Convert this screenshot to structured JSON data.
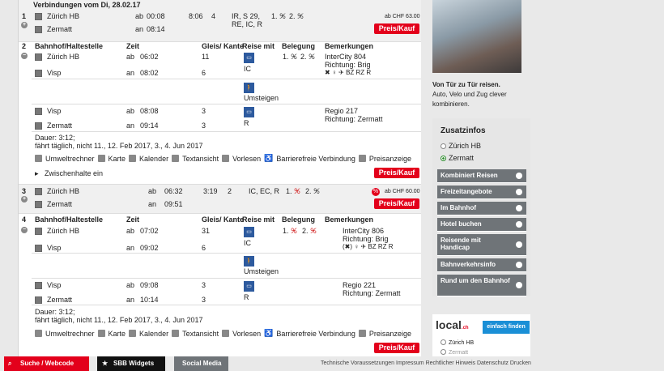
{
  "header": {
    "title": "Verbindungen vom Di, 28.02.17"
  },
  "c1": {
    "num": "1",
    "from": "Zürich HB",
    "to": "Zermatt",
    "dep_k": "ab",
    "arr_k": "an",
    "dep": "00:08",
    "arr": "08:14",
    "dur": "8:06",
    "chg": "4",
    "prod1": "IR, S 29,",
    "prod2": "RE, IC, R",
    "occ1": "1.",
    "occ2": "2.",
    "price": "ab CHF 63.00",
    "buy": "Preis/Kauf"
  },
  "cols": {
    "stop": "Bahnhof/Haltestelle",
    "time": "Zeit",
    "track": "Gleis/ Kante",
    "via": "Reise mit",
    "occ": "Belegung",
    "notes": "Bemerkungen"
  },
  "c2": {
    "num": "2",
    "l1_from": "Zürich HB",
    "l1_dep": "06:02",
    "l1_track": "11",
    "l1_to": "Visp",
    "l1_arr": "08:02",
    "l1_track2": "6",
    "l1_prod": "IC",
    "l1_occ1": "1.",
    "l1_occ2": "2.",
    "l1_note1": "InterCity 804",
    "l1_note2": "Richtung: Brig",
    "l1_note3": "BZ RZ",
    "walk": "Umsteigen",
    "l2_from": "Visp",
    "l2_dep": "08:08",
    "l2_track": "3",
    "l2_to": "Zermatt",
    "l2_arr": "09:14",
    "l2_track2": "3",
    "l2_prod": "R",
    "l2_note1": "Regio 217",
    "l2_note2": "Richtung: Zermatt",
    "dauer": "Dauer: 3:12;",
    "faehrt": "fährt täglich, nicht 11., 12. Feb 2017, 3., 4. Jun 2017",
    "zwischen": "Zwischenhalte ein",
    "buy": "Preis/Kauf"
  },
  "tools": {
    "t1": "Umweltrechner",
    "t2": "Karte",
    "t3": "Kalender",
    "t4": "Textansicht",
    "t5": "Vorlesen",
    "t6": "Barrierefreie Verbindung",
    "t7": "Preisanzeige"
  },
  "c3": {
    "num": "3",
    "from": "Zürich HB",
    "to": "Zermatt",
    "dep": "06:32",
    "arr": "09:51",
    "dur": "3:19",
    "chg": "2",
    "prod": "IC, EC, R",
    "occ1": "1.",
    "occ2": "2.",
    "price": "ab CHF 60.00",
    "buy": "Preis/Kauf"
  },
  "c4": {
    "num": "4",
    "l1_from": "Zürich HB",
    "l1_dep": "07:02",
    "l1_track": "31",
    "l1_to": "Visp",
    "l1_arr": "09:02",
    "l1_track2": "6",
    "l1_prod": "IC",
    "l1_occ1": "1.",
    "l1_occ2": "2.",
    "l1_note1": "InterCity 806",
    "l1_note2": "Richtung: Brig",
    "l1_note3": "BZ RZ",
    "walk": "Umsteigen",
    "l2_from": "Visp",
    "l2_dep": "09:08",
    "l2_track": "3",
    "l2_to": "Zermatt",
    "l2_arr": "10:14",
    "l2_track2": "3",
    "l2_prod": "R",
    "l2_note1": "Regio 221",
    "l2_note2": "Richtung: Zermatt",
    "dauer": "Dauer: 3:12;",
    "faehrt": "fährt täglich, nicht 11., 12. Feb 2017, 3., 4. Jun 2017",
    "buy": "Preis/Kauf"
  },
  "side": {
    "promo_title": "Von Tür zu Tür reisen.",
    "promo_text1": "Auto, Velo und Zug clever",
    "promo_text2": "kombinieren.",
    "zusatz": "Zusatzinfos",
    "opt1": "Zürich HB",
    "opt2": "Zermatt",
    "menu": [
      "Kombiniert Reisen",
      "Freizeitangebote",
      "Im Bahnhof",
      "Hotel buchen",
      "Reisende mit Handicap",
      "Bahnverkehrsinfo",
      "Rund um den Bahnhof"
    ],
    "local": "local",
    "local_sub": ".ch",
    "local_btn": "einfach finden",
    "lopt1": "Zürich HB",
    "lopt2": "Zermatt"
  },
  "footer": {
    "search": "Suche / Webcode",
    "widgets": "SBB Widgets",
    "social": "Social Media",
    "links": "Technische Voraussetzungen  Impressum  Rechtlicher Hinweis  Datenschutz  Drucken"
  },
  "colors": {
    "red": "#e3001b",
    "menu": "#6f7478",
    "train": "#2d5a9e"
  }
}
